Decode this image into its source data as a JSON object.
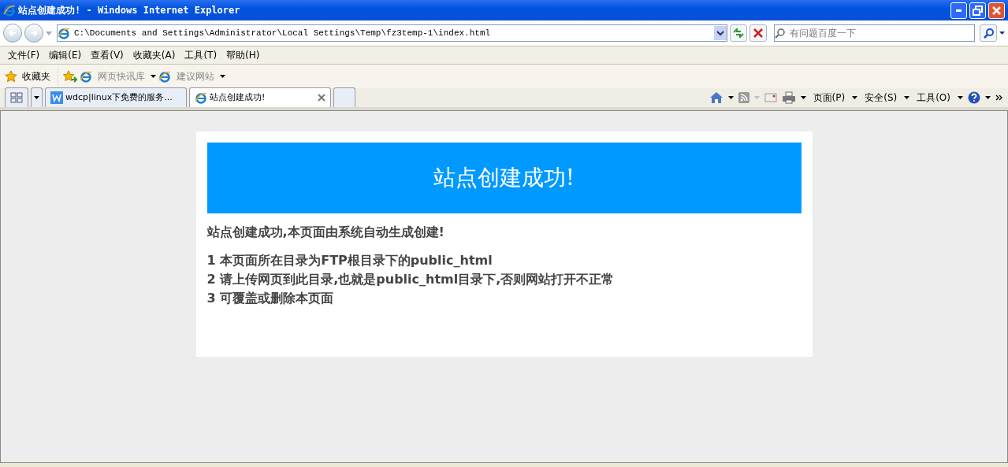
{
  "window": {
    "title": "站点创建成功! - Windows Internet Explorer"
  },
  "address_bar": {
    "value": "C:\\Documents and Settings\\Administrator\\Local Settings\\Temp\\fz3temp-1\\index.html"
  },
  "search": {
    "placeholder": "有问题百度一下"
  },
  "menu": [
    "文件(F)",
    "编辑(E)",
    "查看(V)",
    "收藏夹(A)",
    "工具(T)",
    "帮助(H)"
  ],
  "favorites_bar": {
    "label": "收藏夹",
    "links": [
      "网页快讯库",
      "建议网站"
    ]
  },
  "tabs": [
    {
      "label": "wdcp|linux下免费的服务...",
      "selected": false
    },
    {
      "label": "站点创建成功!",
      "selected": true
    }
  ],
  "command_bar": [
    "页面(P)",
    "安全(S)",
    "工具(O)"
  ],
  "page": {
    "banner": "站点创建成功!",
    "intro": "站点创建成功,本页面由系统自动生成创建!",
    "lines": [
      "1 本页面所在目录为FTP根目录下的public_html",
      "2 请上传网页到此目录,也就是public_html目录下,否则网站打开不正常",
      "3 可覆盖或删除本页面"
    ]
  }
}
